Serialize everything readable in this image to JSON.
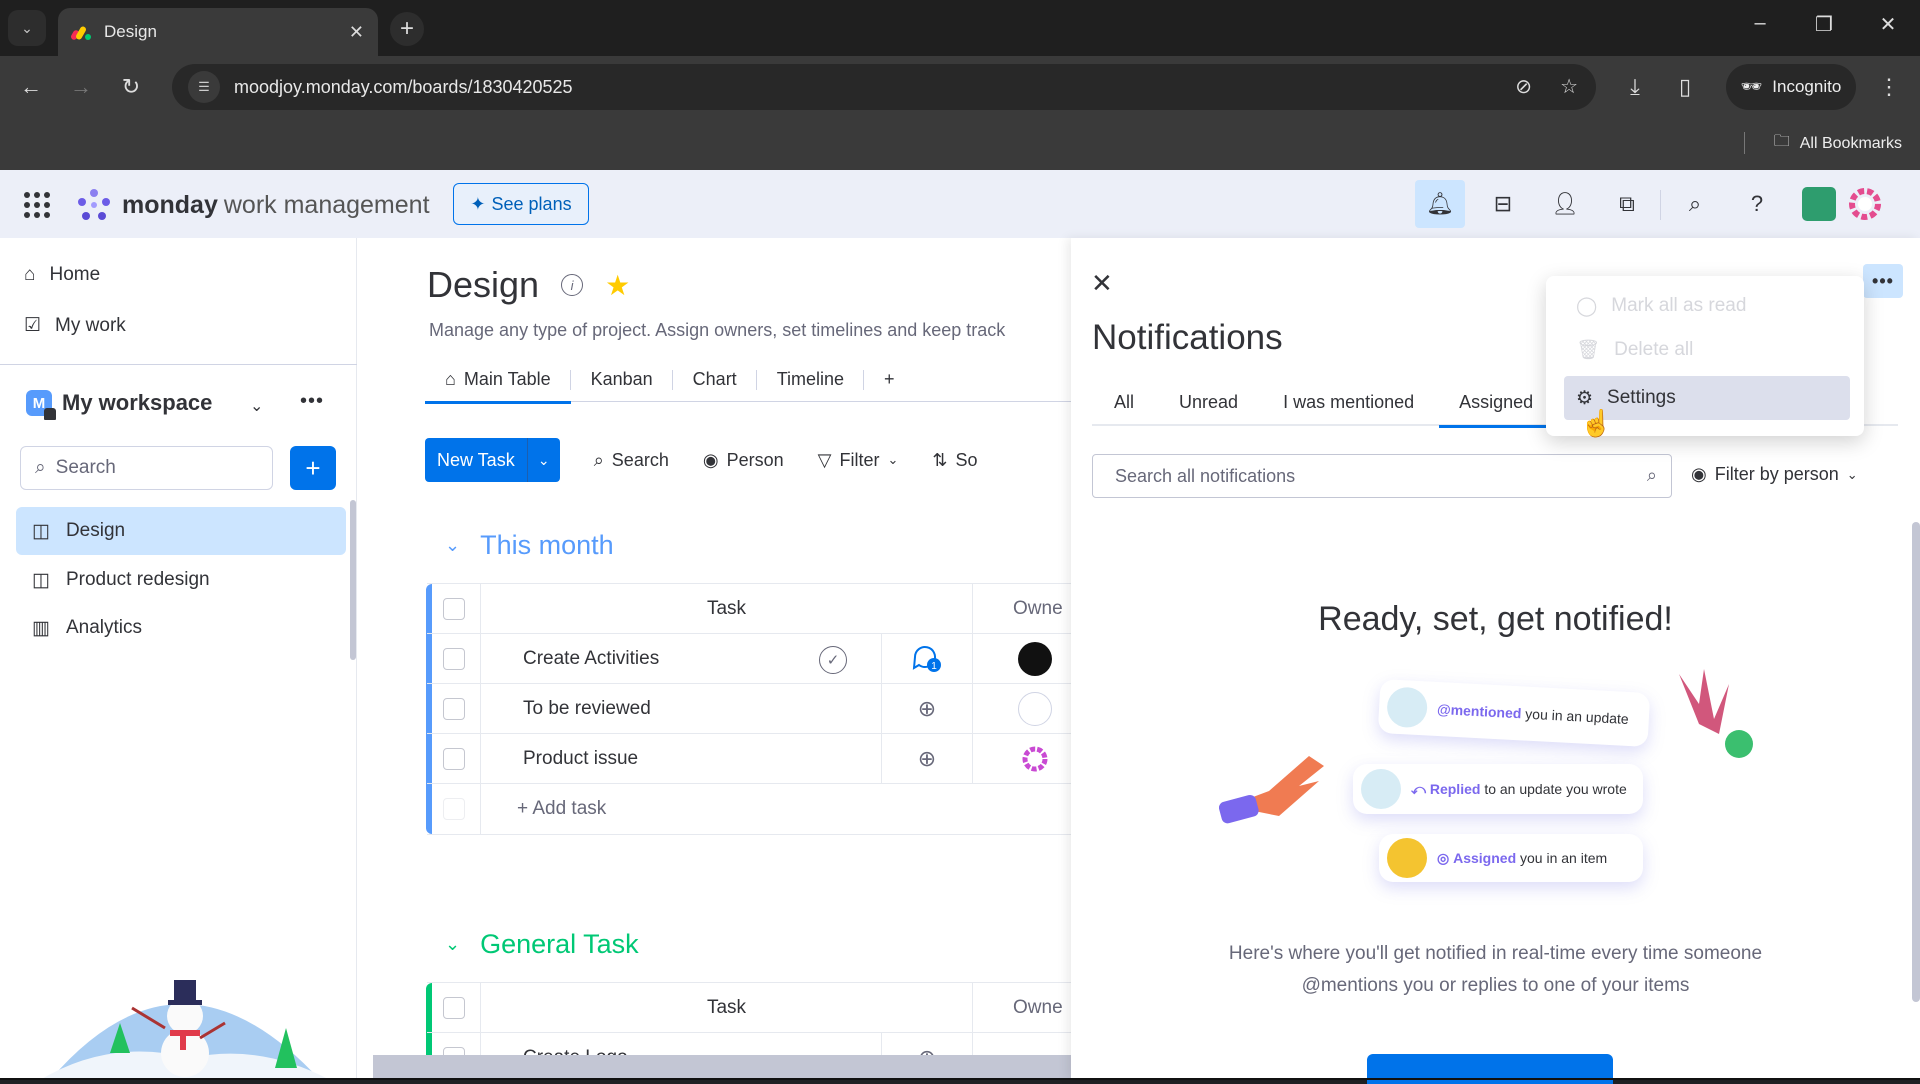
{
  "browser": {
    "tab_title": "Design",
    "url": "moodjoy.monday.com/boards/1830420525",
    "incognito_label": "Incognito",
    "bookmarks_label": "All Bookmarks"
  },
  "header": {
    "brand_bold": "monday",
    "brand_rest": "work management",
    "see_plans": "See plans"
  },
  "sidebar": {
    "nav": [
      {
        "label": "Home"
      },
      {
        "label": "My work"
      }
    ],
    "workspace": {
      "initial": "M",
      "name": "My workspace"
    },
    "search_placeholder": "Search",
    "boards": [
      {
        "label": "Design",
        "active": true
      },
      {
        "label": "Product redesign",
        "active": false
      },
      {
        "label": "Analytics",
        "active": false
      }
    ]
  },
  "board": {
    "title": "Design",
    "description": "Manage any type of project. Assign owners, set timelines and keep track",
    "views": [
      {
        "label": "Main Table"
      },
      {
        "label": "Kanban"
      },
      {
        "label": "Chart"
      },
      {
        "label": "Timeline"
      },
      {
        "label": "+"
      }
    ],
    "toolbar": {
      "new_task": "New Task",
      "search": "Search",
      "person": "Person",
      "filter": "Filter",
      "sort": "So"
    },
    "groups": [
      {
        "name": "This month",
        "color": "#579bfc",
        "columns": {
          "task": "Task",
          "owner": "Owne"
        },
        "rows": [
          {
            "task": "Create Activities",
            "updates": 1
          },
          {
            "task": "To be reviewed"
          },
          {
            "task": "Product issue"
          }
        ],
        "add_label": "+ Add task"
      },
      {
        "name": "General Task",
        "color": "#00c875",
        "columns": {
          "task": "Task",
          "owner": "Owne"
        },
        "rows": [
          {
            "task": "Create Logo"
          }
        ]
      }
    ]
  },
  "notifications": {
    "title": "Notifications",
    "tabs": [
      {
        "label": "All"
      },
      {
        "label": "Unread"
      },
      {
        "label": "I was mentioned"
      },
      {
        "label": "Assigned",
        "active": true
      }
    ],
    "search_placeholder": "Search all notifications",
    "filter_label": "Filter by person",
    "empty_title": "Ready, set, get notified!",
    "cards": [
      {
        "action": "@mentioned",
        "rest": "you in an update"
      },
      {
        "action": "Replied",
        "rest": "to an update you wrote"
      },
      {
        "action": "Assigned",
        "rest": "you in an item"
      }
    ],
    "empty_desc_1": "Here's where you'll get notified in real-time every time someone",
    "empty_desc_2": "@mentions you or replies to one of your items",
    "menu": [
      {
        "label": "Mark all as read",
        "state": "disabled"
      },
      {
        "label": "Delete all",
        "state": "disabled"
      },
      {
        "label": "Settings",
        "state": "hover"
      }
    ]
  }
}
